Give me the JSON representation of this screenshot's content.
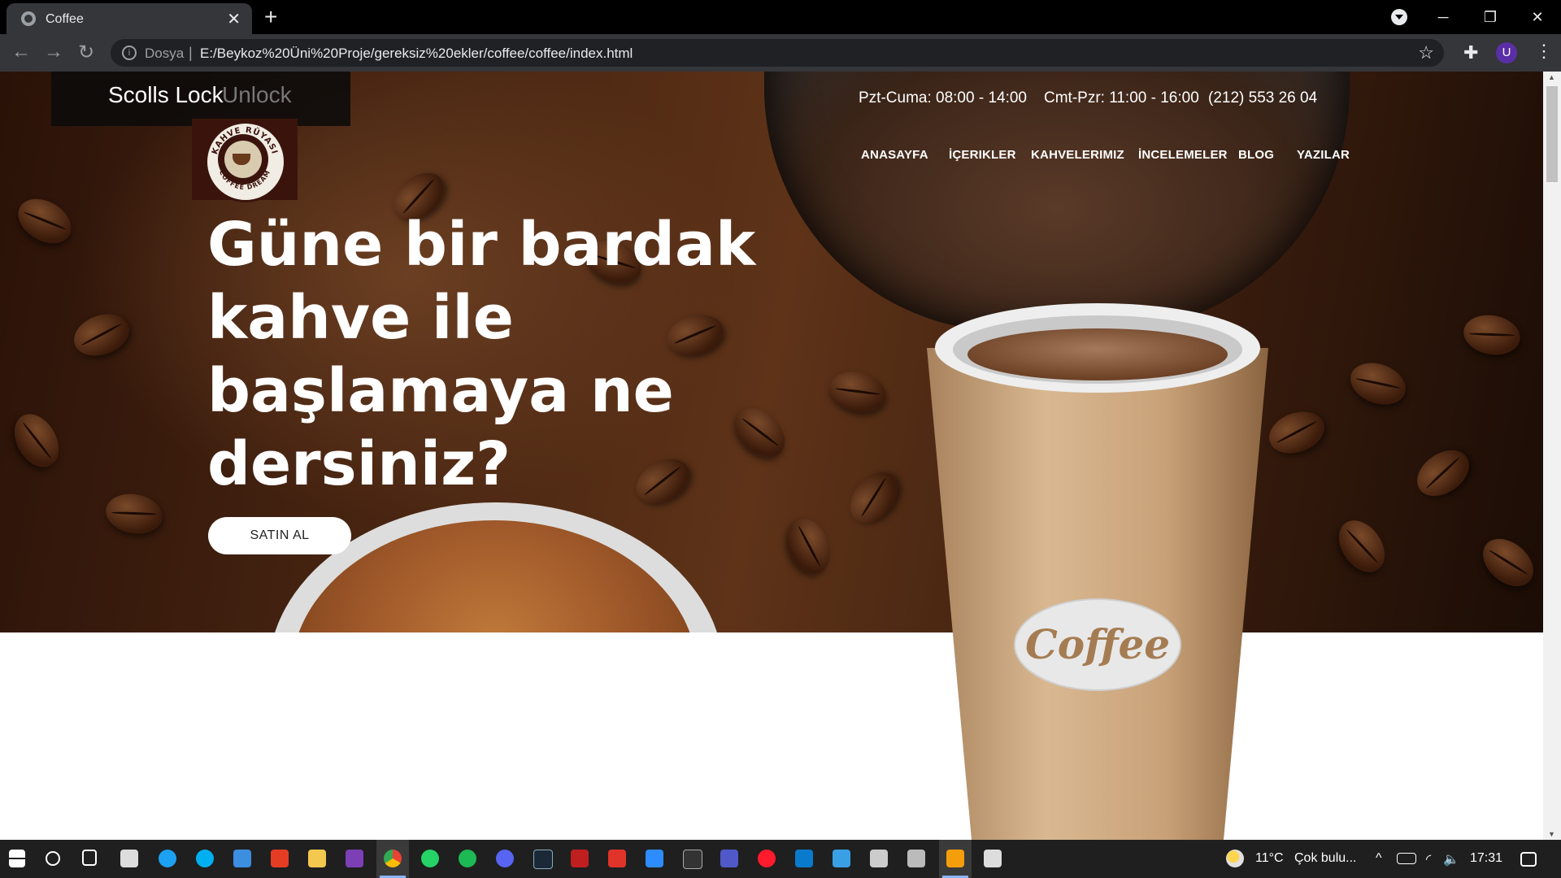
{
  "browser": {
    "tab_title": "Coffee",
    "address_prefix": "Dosya",
    "url": "E:/Beykoz%20Üni%20Proje/gereksiz%20ekler/coffee/coffee/index.html",
    "account_initial": "U"
  },
  "overlay": {
    "scroll_lock": "Scolls Lock",
    "unlock": "Unlock"
  },
  "site": {
    "hours_weekday": "Pzt-Cuma: 08:00 - 14:00",
    "hours_weekend": "Cmt-Pzr: 11:00 - 16:00",
    "phone": "(212) 553 26 04",
    "logo_text_top": "KAHVE RÜYASI",
    "logo_text_bottom": "COFFEE DREAM",
    "nav": [
      "ANASAYFA",
      "İÇERIKLER",
      "KAHVELERIMIZ",
      "İNCELEMELER",
      "BLOG",
      "YAZILAR"
    ],
    "headline": [
      "Güne bir bardak",
      "kahve ile",
      "başlamaya ne",
      "dersiniz?"
    ],
    "cta": "SATIN AL",
    "cup_label": "Coffee"
  },
  "taskbar": {
    "weather_temp": "11°C",
    "weather_desc": "Çok bulu...",
    "time": "17:31"
  }
}
